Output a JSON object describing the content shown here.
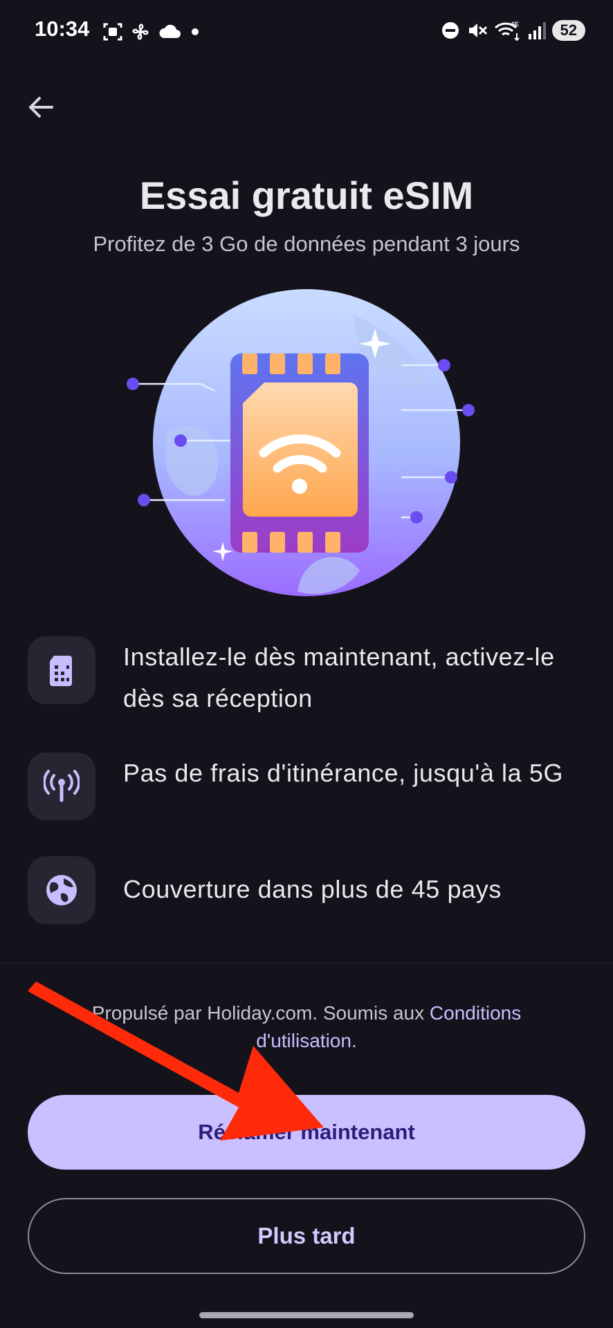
{
  "status_bar": {
    "time": "10:34",
    "left_icons": [
      "screenshot-icon",
      "fan-icon",
      "cloud-icon",
      "dot-icon"
    ],
    "right_icons": [
      "dnd-icon",
      "mute-icon",
      "wifi-6e-icon",
      "signal-icon"
    ],
    "battery": "52"
  },
  "header": {
    "back_icon": "arrow-left-icon",
    "title": "Essai gratuit eSIM",
    "subtitle": "Profitez de 3 Go de données pendant 3 jours"
  },
  "hero": {
    "illustration": "esim-globe-illustration"
  },
  "features": [
    {
      "icon": "sim-card-icon",
      "text": "Installez-le dès maintenant, activez-le dès sa réception"
    },
    {
      "icon": "antenna-icon",
      "text": "Pas de frais d'itinérance, jusqu'à la 5G"
    },
    {
      "icon": "globe-icon",
      "text": "Couverture dans plus de 45 pays"
    }
  ],
  "legal": {
    "prefix": "Propulsé par Holiday.com. Soumis aux ",
    "link": "Conditions d'utilisation",
    "suffix": "."
  },
  "buttons": {
    "primary": "Réclamer maintenant",
    "secondary": "Plus tard"
  },
  "colors": {
    "background": "#14131c",
    "accent": "#cbc0ff",
    "accent_text": "#2c1d7a",
    "annotation_arrow": "#ff2a0a"
  }
}
